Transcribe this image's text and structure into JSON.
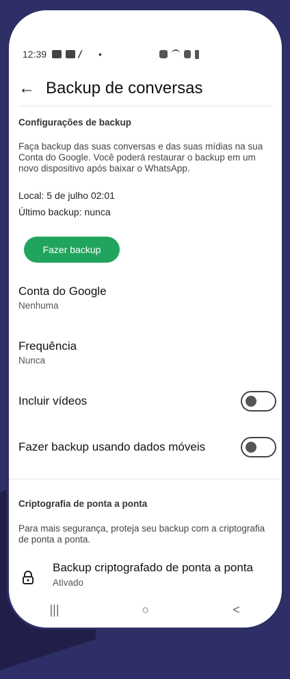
{
  "status_bar": {
    "time": "12:39",
    "dot": "•"
  },
  "app_bar": {
    "back_icon": "arrow-left-icon",
    "title": "Backup de conversas"
  },
  "backup_settings": {
    "heading": "Configurações de backup",
    "description": "Faça backup das suas conversas e das suas mídias na sua Conta do Google. Você poderá restaurar o backup em um novo dispositivo após baixar o WhatsApp.",
    "local": "Local: 5 de julho 02:01",
    "last_backup": "Último backup: nunca",
    "backup_button": "Fazer backup",
    "accent_color": "#21a45d"
  },
  "settings": {
    "google_account": {
      "title": "Conta do Google",
      "value": "Nenhuma"
    },
    "frequency": {
      "title": "Frequência",
      "value": "Nunca"
    },
    "include_videos": {
      "title": "Incluir vídeos",
      "enabled": false
    },
    "mobile_data": {
      "title": "Fazer backup usando dados móveis",
      "enabled": false
    }
  },
  "encryption": {
    "heading": "Criptografia de ponta a ponta",
    "description": "Para mais segurança, proteja seu backup com a criptografia de ponta a ponta.",
    "item_title": "Backup criptografado de ponta a ponta",
    "item_value": "Ativado",
    "icon": "lock-icon"
  },
  "nav_bar": {
    "recent": "|||",
    "home": "○",
    "back": "<"
  }
}
